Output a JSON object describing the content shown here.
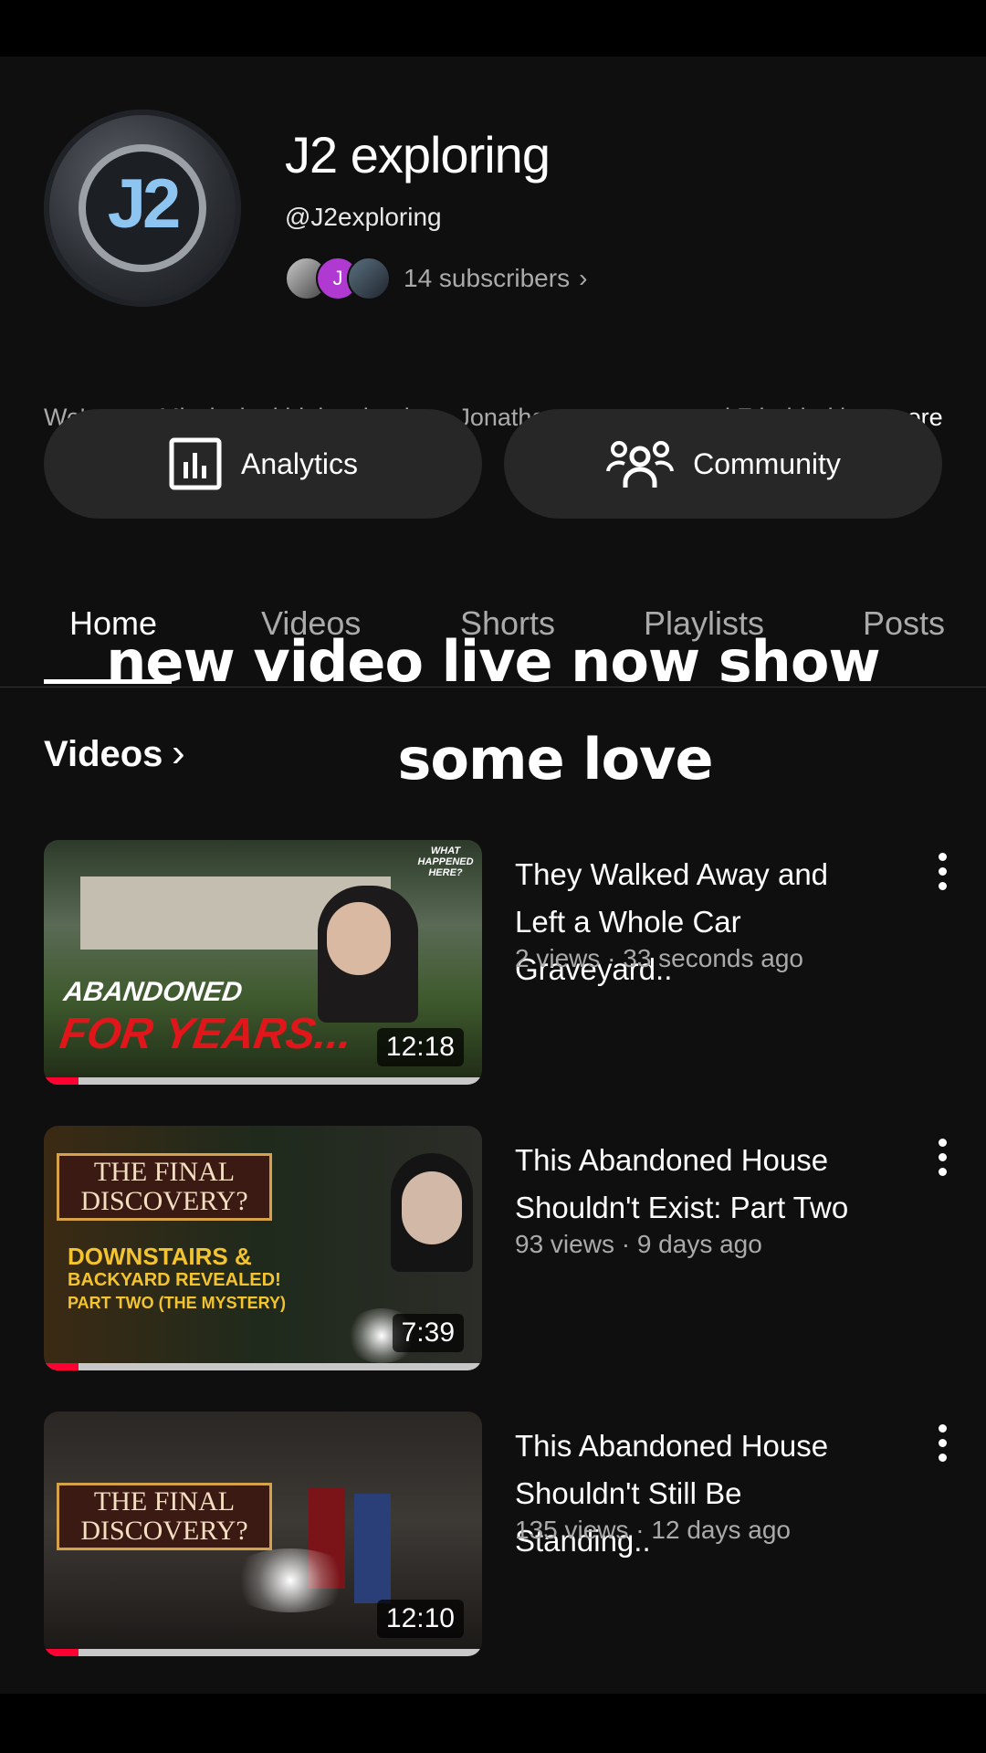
{
  "channel": {
    "avatar_text": "J2",
    "name": "J2 exploring",
    "handle": "@J2exploring",
    "subscriber_initial": "J",
    "subscribers": "14 subscribers",
    "description": "We're two Mississippi high schoolers, Jonathan on camera and Z behind it.",
    "more_label": "...more"
  },
  "buttons": {
    "analytics": "Analytics",
    "community": "Community"
  },
  "tabs": [
    {
      "label": "Home",
      "active": true
    },
    {
      "label": "Videos"
    },
    {
      "label": "Shorts"
    },
    {
      "label": "Playlists"
    },
    {
      "label": "Posts"
    }
  ],
  "overlay": {
    "line1": "new video live now show",
    "line2": "some love"
  },
  "section": {
    "title": "Videos"
  },
  "videos": [
    {
      "title": "They Walked Away and Left a Whole Car Graveyard..",
      "meta": "2 views · 33 seconds ago",
      "duration": "12:18",
      "progress": 0.08,
      "thumb_text": [
        "ABANDONED",
        "FOR YEARS...",
        "WHAT HAPPENED HERE?"
      ]
    },
    {
      "title": "This Abandoned House Shouldn't Exist: Part Two",
      "meta": "93 views · 9 days ago",
      "duration": "7:39",
      "progress": 0.08,
      "thumb_text": [
        "THE FINAL DISCOVERY?",
        "DOWNSTAIRS &",
        "BACKYARD REVEALED!",
        "PART TWO (THE MYSTERY)"
      ]
    },
    {
      "title": "This Abandoned House Shouldn't Still Be Standing..",
      "meta": "135 views · 12 days ago",
      "duration": "12:10",
      "progress": 0.08,
      "thumb_text": [
        "THE FINAL DISCOVERY?"
      ]
    }
  ],
  "colors": {
    "background": "#0f0f0f",
    "pill": "#272727",
    "progress": "#ff0033",
    "secondary_text": "#aaaaaa"
  },
  "icons": [
    "analytics-icon",
    "community-icon",
    "chevron-right-icon",
    "more-vert-icon"
  ]
}
